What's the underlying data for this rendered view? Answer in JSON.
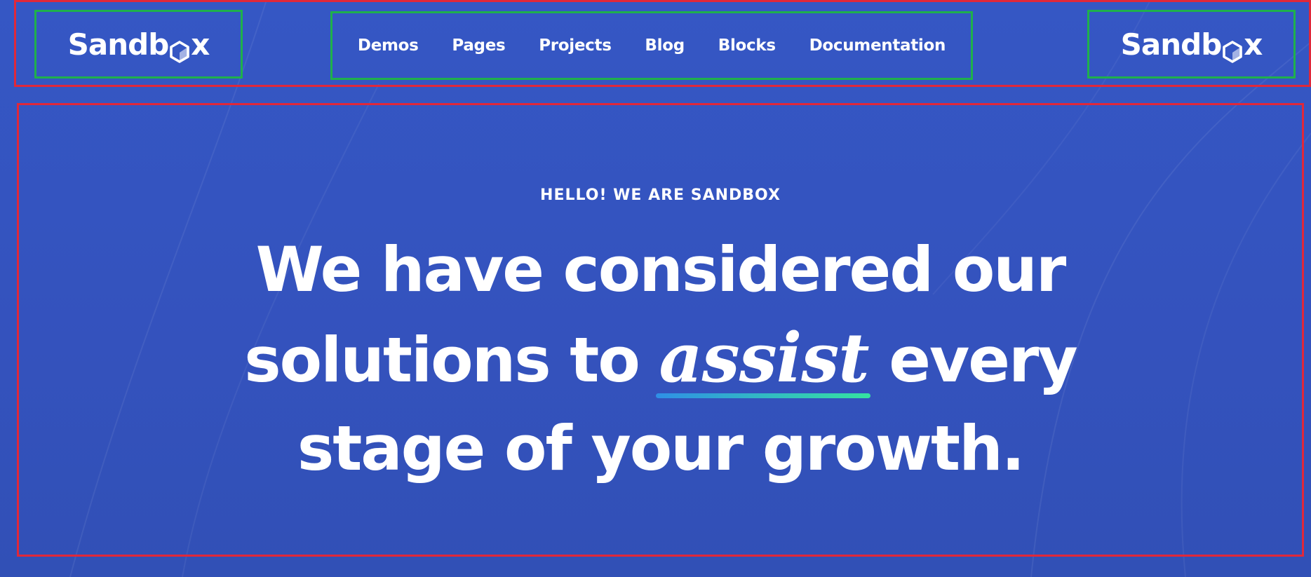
{
  "header": {
    "logo_left": {
      "prefix": "Sandb",
      "suffix": "x",
      "icon": "hexagon-o-icon"
    },
    "logo_right": {
      "prefix": "Sandb",
      "suffix": "x",
      "icon": "hexagon-o-icon"
    },
    "nav": [
      {
        "label": "Demos"
      },
      {
        "label": "Pages"
      },
      {
        "label": "Projects"
      },
      {
        "label": "Blog"
      },
      {
        "label": "Blocks"
      },
      {
        "label": "Documentation"
      }
    ]
  },
  "hero": {
    "eyebrow": "HELLO! WE ARE SANDBOX",
    "headline_line1": "We have considered our",
    "headline_line2_before": "solutions to ",
    "headline_emphasis": "assist",
    "headline_line2_after": " every",
    "headline_line3": "stage of your growth."
  },
  "colors": {
    "background": "#3557c4",
    "text": "#ffffff",
    "underline_gradient_start": "#2f8fe6",
    "underline_gradient_end": "#35e3a0",
    "annotation_region": "#e0283a",
    "annotation_item": "#1fb04c"
  }
}
